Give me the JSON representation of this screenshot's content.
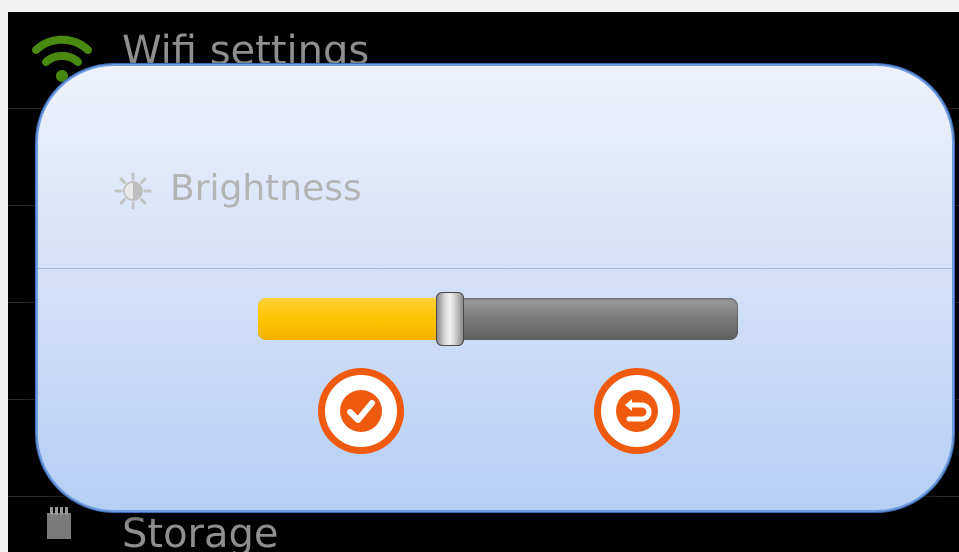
{
  "background_rows": {
    "wifi": {
      "label": "Wifi settings",
      "icon": "wifi-icon"
    },
    "storage": {
      "label": "Storage",
      "icon": "storage-icon"
    }
  },
  "dialog": {
    "title": "Brightness",
    "title_icon": "brightness-icon",
    "slider": {
      "value_percent": 40
    },
    "ok_button": {
      "icon": "checkmark-icon"
    },
    "revert_button": {
      "icon": "undo-icon"
    }
  },
  "colors": {
    "accent_orange": "#f05a0e",
    "slider_fill": "#ffc400",
    "wifi_green": "#4a8a10"
  }
}
